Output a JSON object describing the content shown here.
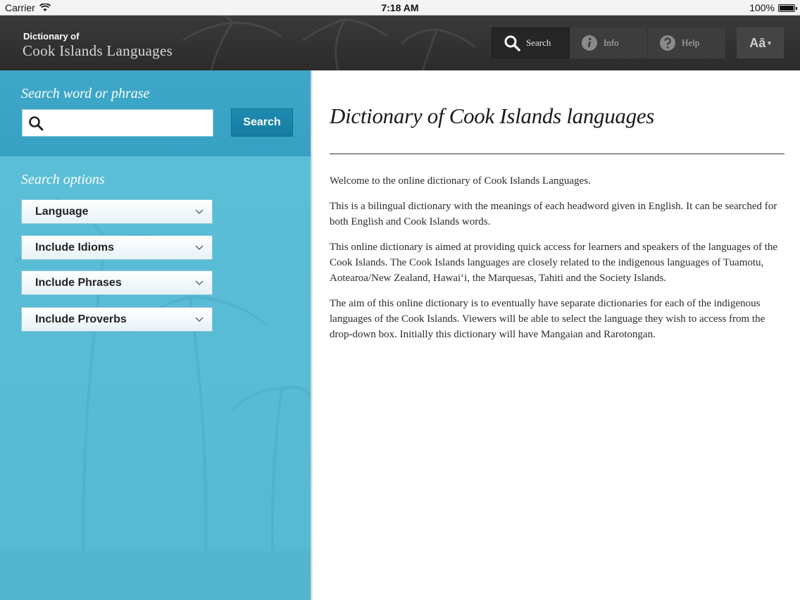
{
  "status_bar": {
    "carrier": "Carrier",
    "time": "7:18 AM",
    "battery": "100%"
  },
  "header": {
    "brand_small": "Dictionary of",
    "brand_large": "Cook Islands Languages",
    "tools": [
      {
        "label": "Search",
        "icon": "search-icon",
        "active": true
      },
      {
        "label": "Info",
        "icon": "info-icon",
        "active": false
      },
      {
        "label": "Help",
        "icon": "help-icon",
        "active": false
      }
    ],
    "font_button": "Aā"
  },
  "sidebar": {
    "search_label": "Search word or phrase",
    "search_value": "",
    "search_placeholder": "",
    "search_button": "Search",
    "options_label": "Search options",
    "options": [
      {
        "label": "Language"
      },
      {
        "label": "Include Idioms"
      },
      {
        "label": "Include Phrases"
      },
      {
        "label": "Include Proverbs"
      }
    ]
  },
  "main": {
    "title": "Dictionary of Cook Islands languages",
    "paragraphs": [
      "Welcome to the online dictionary of Cook Islands Languages.",
      "This is a bilingual dictionary with the meanings of each headword given in English. It can be searched for both English and Cook Islands words.",
      "This online dictionary is aimed at providing quick access for learners and speakers of the languages of the Cook Islands. The Cook Islands languages are closely related to the indigenous languages of Tuamotu, Aotearoa/New Zealand, Hawai‘i, the Marquesas, Tahiti and the Society Islands.",
      "The aim of this online dictionary is to eventually have separate dictionaries for each of the indigenous languages of the Cook Islands. Viewers will be able to select the language they wish to access from the drop-down box. Initially this dictionary will have Mangaian and Rarotongan."
    ]
  },
  "colors": {
    "header_bg": "#2f2f2f",
    "search_area_bg": "#3fa8c9",
    "sidebar_bg": "#5cbfd8",
    "search_button_bg": "#1e8bb1"
  }
}
